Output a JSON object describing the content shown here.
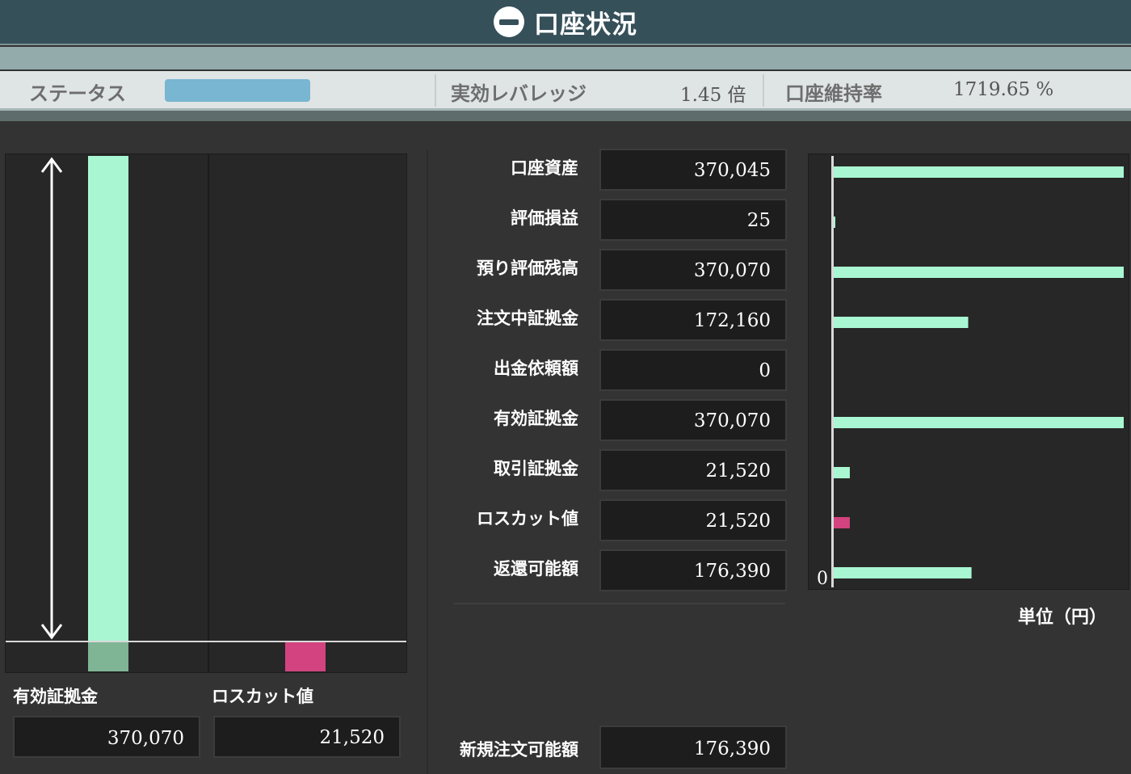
{
  "title": "口座状況",
  "status": {
    "status_label": "ステータス",
    "status_color": "#78b6d2",
    "leverage_label": "実効レバレッジ",
    "leverage_value": "1.45 倍",
    "maintenance_label": "口座維持率",
    "maintenance_value": "1719.65 %"
  },
  "rows": [
    {
      "label": "口座資産",
      "value": "370,045",
      "amount": 370045,
      "color": "#a8f7d2"
    },
    {
      "label": "評価損益",
      "value": "25",
      "amount": 25,
      "color": "#a8f7d2"
    },
    {
      "label": "預り評価残高",
      "value": "370,070",
      "amount": 370070,
      "color": "#a8f7d2"
    },
    {
      "label": "注文中証拠金",
      "value": "172,160",
      "amount": 172160,
      "color": "#a8f7d2"
    },
    {
      "label": "出金依頼額",
      "value": "0",
      "amount": 0,
      "color": "#a8f7d2"
    },
    {
      "label": "有効証拠金",
      "value": "370,070",
      "amount": 370070,
      "color": "#a8f7d2"
    },
    {
      "label": "取引証拠金",
      "value": "21,520",
      "amount": 21520,
      "color": "#a8f7d2"
    },
    {
      "label": "ロスカット値",
      "value": "21,520",
      "amount": 21520,
      "color": "#d2437f"
    },
    {
      "label": "返還可能額",
      "value": "176,390",
      "amount": 176390,
      "color": "#a8f7d2"
    }
  ],
  "new_order": {
    "label": "新規注文可能額",
    "value": "176,390"
  },
  "bar_chart": {
    "left_label": "有効証拠金",
    "left_value": "370,070",
    "left_amount": 370070,
    "right_label": "ロスカット値",
    "right_value": "21,520",
    "right_amount": 21520,
    "green": "#a8f7d2",
    "pink": "#d2437f"
  },
  "hbar": {
    "zero_label": "0",
    "unit_label": "単位（円）",
    "max": 370070
  }
}
